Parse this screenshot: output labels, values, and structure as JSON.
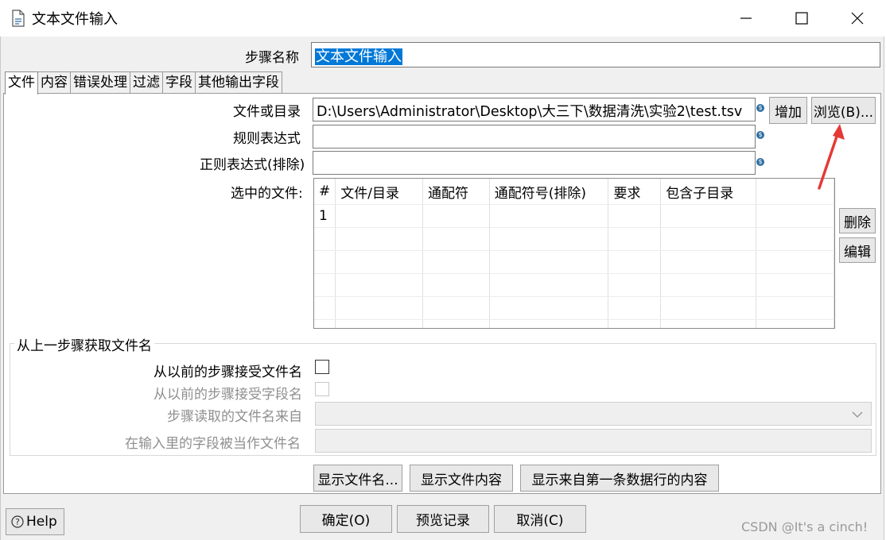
{
  "window": {
    "title": "文本文件输入",
    "min_icon": "minimize-icon",
    "max_icon": "maximize-icon",
    "close_icon": "close-icon"
  },
  "step_name": {
    "label": "步骤名称",
    "value": "文本文件输入"
  },
  "tabs": [
    {
      "label": "文件",
      "active": true
    },
    {
      "label": "内容"
    },
    {
      "label": "错误处理"
    },
    {
      "label": "过滤"
    },
    {
      "label": "字段"
    },
    {
      "label": "其他输出字段"
    }
  ],
  "file_tab": {
    "file_or_dir_label": "文件或目录",
    "file_or_dir_value": "D:\\Users\\Administrator\\Desktop\\大三下\\数据清洗\\实验2\\test.tsv",
    "regex_label": "规则表达式",
    "regex_value": "",
    "regex_exclude_label": "正则表达式(排除)",
    "regex_exclude_value": "",
    "add_button": "增加",
    "browse_button": "浏览(B)...",
    "selected_files_label": "选中的文件:",
    "table": {
      "columns": [
        "#",
        "文件/目录",
        "通配符",
        "通配符号(排除)",
        "要求",
        "包含子目录"
      ],
      "rows": [
        [
          "1",
          "",
          "",
          "",
          "",
          ""
        ]
      ]
    },
    "delete_button": "删除",
    "edit_button": "编辑"
  },
  "prev_step_group": {
    "title": "从上一步骤获取文件名",
    "accept_filenames_label": "从以前的步骤接受文件名",
    "accept_fieldname_label": "从以前的步骤接受字段名",
    "step_to_read_label": "步骤读取的文件名来自",
    "field_as_filename_label": "在输入里的字段被当作文件名"
  },
  "panel_buttons": {
    "show_filenames": "显示文件名...",
    "show_file_content": "显示文件内容",
    "show_first_row_content": "显示来自第一条数据行的内容"
  },
  "footer": {
    "help": "Help",
    "ok": "确定(O)",
    "preview": "预览记录",
    "cancel": "取消(C)"
  },
  "watermark": "CSDN @It's a cinch!",
  "colors": {
    "selection": "#0078d7",
    "annotation_arrow": "#e53935"
  }
}
